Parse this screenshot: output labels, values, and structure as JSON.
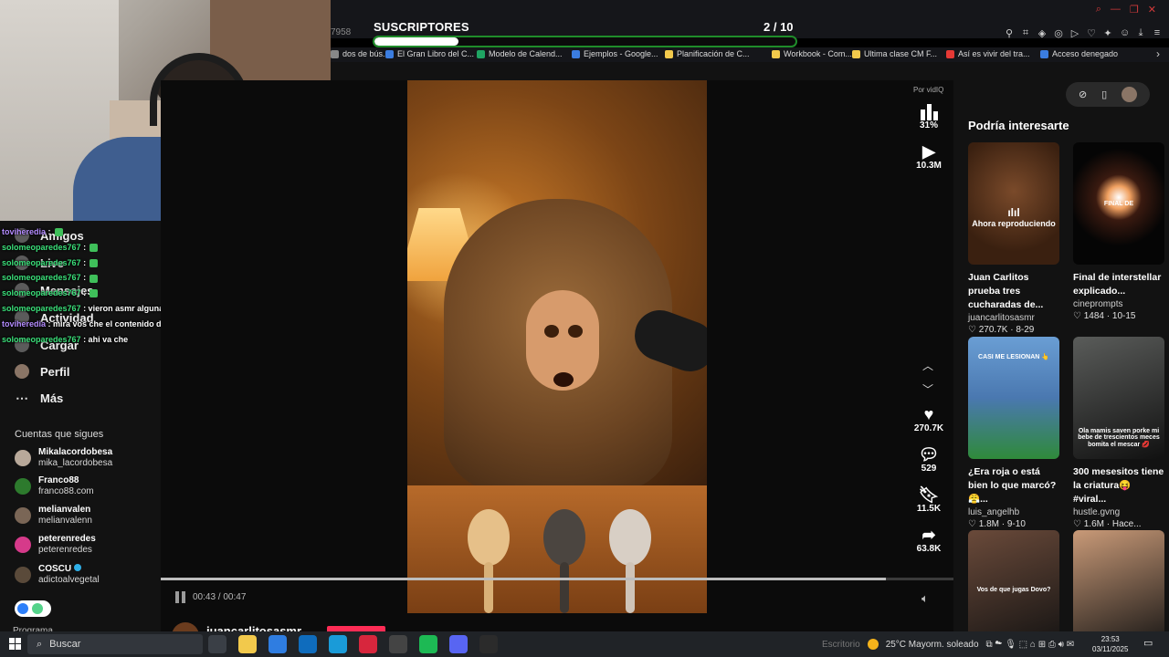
{
  "stream_overlay": {
    "subs_label": "SUSCRIPTORES",
    "subs_count": "2 / 10",
    "subs_progress": 0.2
  },
  "browser": {
    "url_fragment": "7958",
    "bookmarks": [
      {
        "label": "dos de bús...",
        "color": "#888888"
      },
      {
        "label": "El Gran Libro del C...",
        "color": "#3b7de0"
      },
      {
        "label": "Modelo de Calend...",
        "color": "#1fa463"
      },
      {
        "label": "Ejemplos - Google...",
        "color": "#3b7de0"
      },
      {
        "label": "Planificación de C...",
        "color": "#f2c94c"
      },
      {
        "label": "Workbook - Com...",
        "color": "#f2c94c"
      },
      {
        "label": "Ultima clase CM F...",
        "color": "#f2c94c"
      },
      {
        "label": "Así es vivir del tra...",
        "color": "#e53935"
      },
      {
        "label": "Acceso denegado",
        "color": "#3b7de0"
      }
    ],
    "more_chevron": "›"
  },
  "sidebar": {
    "nav": [
      {
        "label": "Amigos"
      },
      {
        "label": "Live"
      },
      {
        "label": "Mensajes"
      },
      {
        "label": "Actividad"
      },
      {
        "label": "Cargar"
      },
      {
        "label": "Perfil"
      },
      {
        "label": "Más"
      }
    ],
    "following_header": "Cuentas que sigues",
    "following": [
      {
        "name": "Mikalacordobesa",
        "handle": "mika_lacordobesa",
        "color": "#b8a99a",
        "verified": false
      },
      {
        "name": "Franco88",
        "handle": "franco88.com",
        "color": "#2d7a2d",
        "verified": false
      },
      {
        "name": "melianvalen",
        "handle": "melianvalenn",
        "color": "#7a6656",
        "verified": false
      },
      {
        "name": "peterenredes",
        "handle": "peterenredes",
        "color": "#d63a8a",
        "verified": false
      },
      {
        "name": "COSCU",
        "handle": "adictoalvegetal",
        "color": "#5a4a3a",
        "verified": true
      }
    ],
    "program_label": "Programa"
  },
  "chat": [
    {
      "user": "toviheredia",
      "msg": ":",
      "emote": true,
      "color": "purple"
    },
    {
      "user": "solomeoparedes767",
      "msg": ":",
      "emote": true,
      "color": "green"
    },
    {
      "user": "solomeoparedes767",
      "msg": ":",
      "emote": true,
      "color": "green"
    },
    {
      "user": "solomeoparedes767",
      "msg": ":",
      "emote": true,
      "color": "green"
    },
    {
      "user": "solomeoparedes767",
      "msg": ":",
      "emote": true,
      "color": "green"
    },
    {
      "user": "solomeoparedes767",
      "msg": ": vieron asmr alguna ves?",
      "emote": false,
      "color": "green"
    },
    {
      "user": "toviheredia",
      "msg": ": mira vos che el contenido de benja eu",
      "emote": false,
      "color": "purple"
    },
    {
      "user": "solomeoparedes767",
      "msg": ": ahi va che",
      "emote": false,
      "color": "green"
    }
  ],
  "player": {
    "time": "00:43 / 00:47",
    "progress": 0.9149,
    "author": "juancarlitosasmr",
    "by_vidiq": "Por vidIQ",
    "vidiq_score": "31%",
    "views": "10.3M",
    "likes": "270.7K",
    "comments": "529",
    "saves": "11.5K",
    "shares": "63.8K"
  },
  "recommendations": {
    "title": "Podría interesarte",
    "now_playing": "Ahora reproduciendo",
    "cards": [
      {
        "title": "Juan Carlitos prueba tres cucharadas de...",
        "author": "juancarlitosasmr",
        "likes": "270.7K",
        "date": "8-29",
        "thumb_color": "#5b3a22",
        "overlay": ""
      },
      {
        "title": "Final de interstellar explicado...",
        "author": "cineprompts",
        "likes": "1484",
        "date": "10-15",
        "thumb_color": "#1a1410",
        "overlay": "FINAL DE"
      },
      {
        "title": "¿Era roja o está bien lo que marcó? 😤...",
        "author": "luis_angelhb",
        "likes": "1.8M",
        "date": "9-10",
        "thumb_color": "#4a78b0",
        "overlay": "CASI ME LESIONAN 👆"
      },
      {
        "title": "300 mesesitos tiene la criatura😝 #viral...",
        "author": "hustle.gvng",
        "likes": "1.6M",
        "date": "Hace...",
        "thumb_color": "#5a5c5a",
        "overlay": "Ola mamis saven porke mi bebe de trescientos meces bomita el mescar 💋"
      },
      {
        "title": "",
        "author": "",
        "likes": "",
        "date": "",
        "thumb_color": "#6a4a3a",
        "overlay": "Vos de que jugas Dovo?"
      },
      {
        "title": "",
        "author": "",
        "likes": "",
        "date": "",
        "thumb_color": "#c99a78",
        "overlay": ""
      }
    ]
  },
  "taskbar": {
    "search_label": "Buscar",
    "tray_hint": "Escritorio",
    "weather": "25°C  Mayorm. soleado",
    "time": "23:53",
    "date": "03/11/2025"
  }
}
